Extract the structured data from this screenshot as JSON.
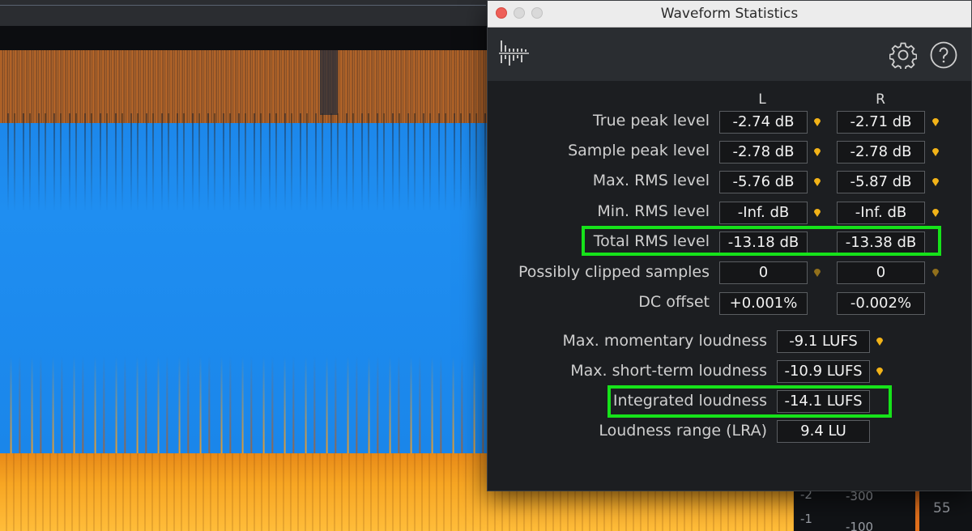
{
  "window": {
    "title": "Waveform Statistics"
  },
  "toolbar": {
    "meter_icon": "meter-icon",
    "settings_icon": "gear-icon",
    "help_icon": "help-icon"
  },
  "columns": {
    "left": "L",
    "right": "R"
  },
  "channel_stats": [
    {
      "label": "True peak level",
      "l": "-2.74 dB",
      "r": "-2.71 dB"
    },
    {
      "label": "Sample peak level",
      "l": "-2.78 dB",
      "r": "-2.78 dB"
    },
    {
      "label": "Max. RMS level",
      "l": "-5.76 dB",
      "r": "-5.87 dB"
    },
    {
      "label": "Min. RMS level",
      "l": "-Inf. dB",
      "r": "-Inf. dB"
    },
    {
      "label": "Total RMS level",
      "l": "-13.18 dB",
      "r": "-13.38 dB"
    },
    {
      "label": "Possibly clipped samples",
      "l": "0",
      "r": "0"
    },
    {
      "label": "DC offset",
      "l": "+0.001%",
      "r": "-0.002%"
    }
  ],
  "loudness_stats": [
    {
      "label": "Max. momentary loudness",
      "value": "-9.1 LUFS"
    },
    {
      "label": "Max. short-term loudness",
      "value": "-10.9 LUFS"
    },
    {
      "label": "Integrated loudness",
      "value": "-14.1 LUFS"
    },
    {
      "label": "Loudness range (LRA)",
      "value": "9.4 LU"
    }
  ],
  "ruler": {
    "db_a": "-2",
    "db_b": "-1",
    "hz_a": "-300",
    "hz_b": "-100",
    "level": "55"
  },
  "colors": {
    "highlight": "#16e21a",
    "pin": "#f2b318",
    "waveform_blue": "#1f8ef1",
    "spectrogram_orange": "#f7a623"
  }
}
